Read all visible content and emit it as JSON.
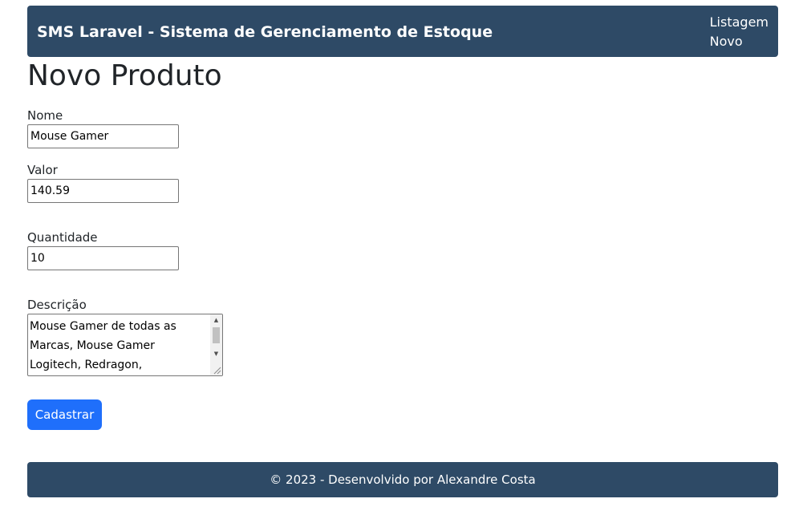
{
  "navbar": {
    "brand": "SMS Laravel - Sistema de Gerenciamento de Estoque",
    "links": [
      "Listagem",
      "Novo"
    ]
  },
  "page": {
    "title": "Novo Produto"
  },
  "form": {
    "nome": {
      "label": "Nome",
      "value": "Mouse Gamer"
    },
    "valor": {
      "label": "Valor",
      "value": "140.59"
    },
    "quantidade": {
      "label": "Quantidade",
      "value": "10"
    },
    "descricao": {
      "label": "Descrição",
      "value": "Mouse Gamer de todas as Marcas, Mouse Gamer Logitech, Redragon,"
    },
    "submit_label": "Cadastrar"
  },
  "footer": {
    "text": "© 2023 - Desenvolvido por Alexandre Costa"
  },
  "colors": {
    "navbar_bg": "#2e4a66",
    "primary": "#1f6ffb"
  }
}
